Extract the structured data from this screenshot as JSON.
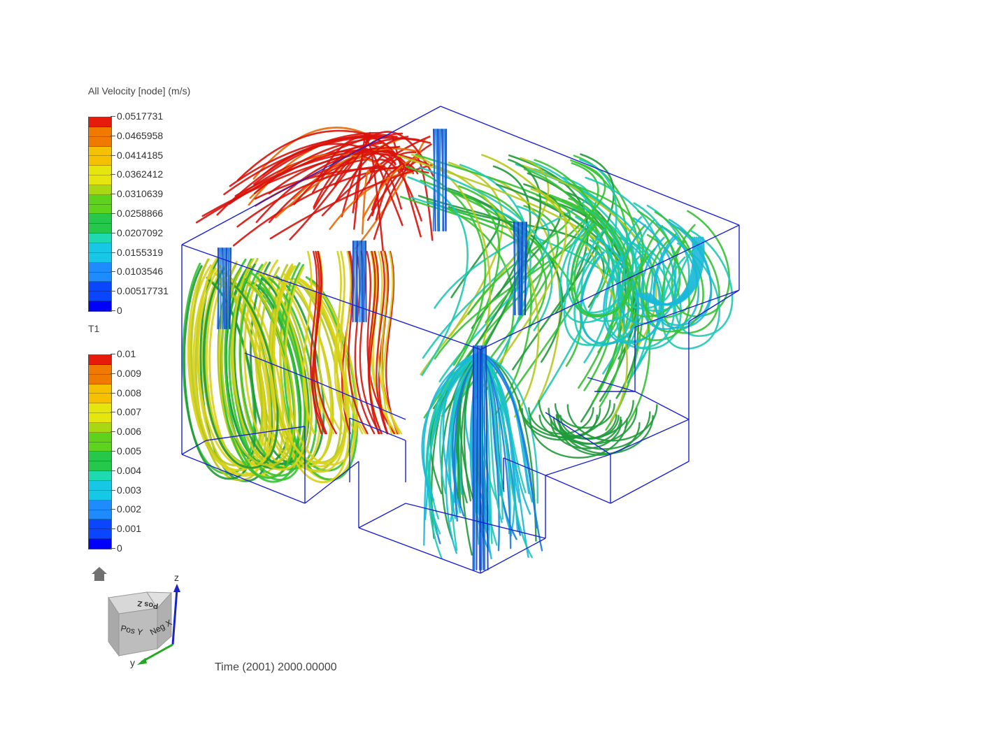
{
  "legends": [
    {
      "title": "All Velocity [node] (m/s)",
      "labels": [
        "0.0517731",
        "0.0465958",
        "0.0414185",
        "0.0362412",
        "0.0310639",
        "0.0258866",
        "0.0207092",
        "0.0155319",
        "0.0103546",
        "0.00517731",
        "0"
      ]
    },
    {
      "title": "T1",
      "labels": [
        "0.01",
        "0.009",
        "0.008",
        "0.007",
        "0.006",
        "0.005",
        "0.004",
        "0.003",
        "0.002",
        "0.001",
        "0"
      ]
    }
  ],
  "colormap": [
    "#0000ff",
    "#0a46ff",
    "#1e8cff",
    "#17c8e6",
    "#1fd9b0",
    "#25c84a",
    "#5fd21e",
    "#a8d812",
    "#e6e60f",
    "#f5c000",
    "#f07a00",
    "#e61b0b"
  ],
  "time_label": "Time (2001) 2000.00000",
  "orientation_cube": {
    "faces": [
      "Pos Z",
      "Pos Y",
      "Neg X"
    ],
    "axes": [
      "z",
      "y"
    ],
    "axis_colors": {
      "z": "#1a24c8",
      "y": "#1faa1f"
    }
  },
  "home_icon": "home-icon",
  "frame_color": "#1a22d4"
}
